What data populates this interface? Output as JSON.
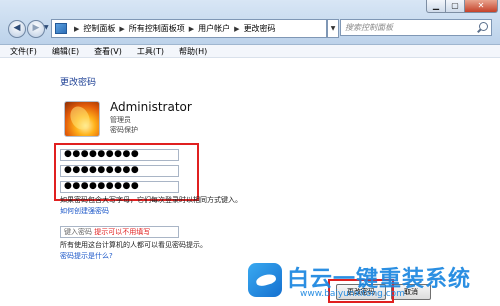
{
  "window": {
    "min_icon": "minimize-icon",
    "max_icon": "maximize-icon",
    "close_icon": "close-icon",
    "close_glyph": "✕",
    "min_glyph": "▁",
    "max_glyph": "▢"
  },
  "nav": {
    "back_glyph": "◀",
    "forward_glyph": "▶",
    "dropdown_glyph": "▼",
    "refresh_glyph": "⟳"
  },
  "address_bar": {
    "breadcrumbs": [
      "控制面板",
      "所有控制面板项",
      "用户帐户",
      "更改密码"
    ],
    "separator": "▶"
  },
  "search": {
    "placeholder": "搜索控制面板"
  },
  "menu": [
    "文件(F)",
    "编辑(E)",
    "查看(V)",
    "工具(T)",
    "帮助(H)"
  ],
  "page": {
    "title": "更改密码",
    "user": {
      "name": "Administrator",
      "type": "管理员",
      "status": "密码保护"
    },
    "password_fields": [
      "●●●●●●●●●",
      "●●●●●●●●●",
      "●●●●●●●●●"
    ],
    "caps_warning": "如果密码包含大写字母，它们每次登录时以相同方式键入。",
    "caps_link": "如何创建强密码",
    "hint_field": {
      "placeholder": "键入密码",
      "annotation": "提示可以不用填写"
    },
    "hint_note": "所有使用这台计算机的人都可以看见密码提示。",
    "hint_link": "密码提示是什么?",
    "buttons": {
      "change": "更改密码",
      "cancel": "取消"
    }
  },
  "watermark": {
    "title": "白云一键重装系统",
    "url": "www.baiyunxitong.com"
  },
  "colors": {
    "accent": "#1c3f94",
    "link": "#1a56c8",
    "highlight": "#e02020",
    "watermark": "#1a86e0"
  }
}
